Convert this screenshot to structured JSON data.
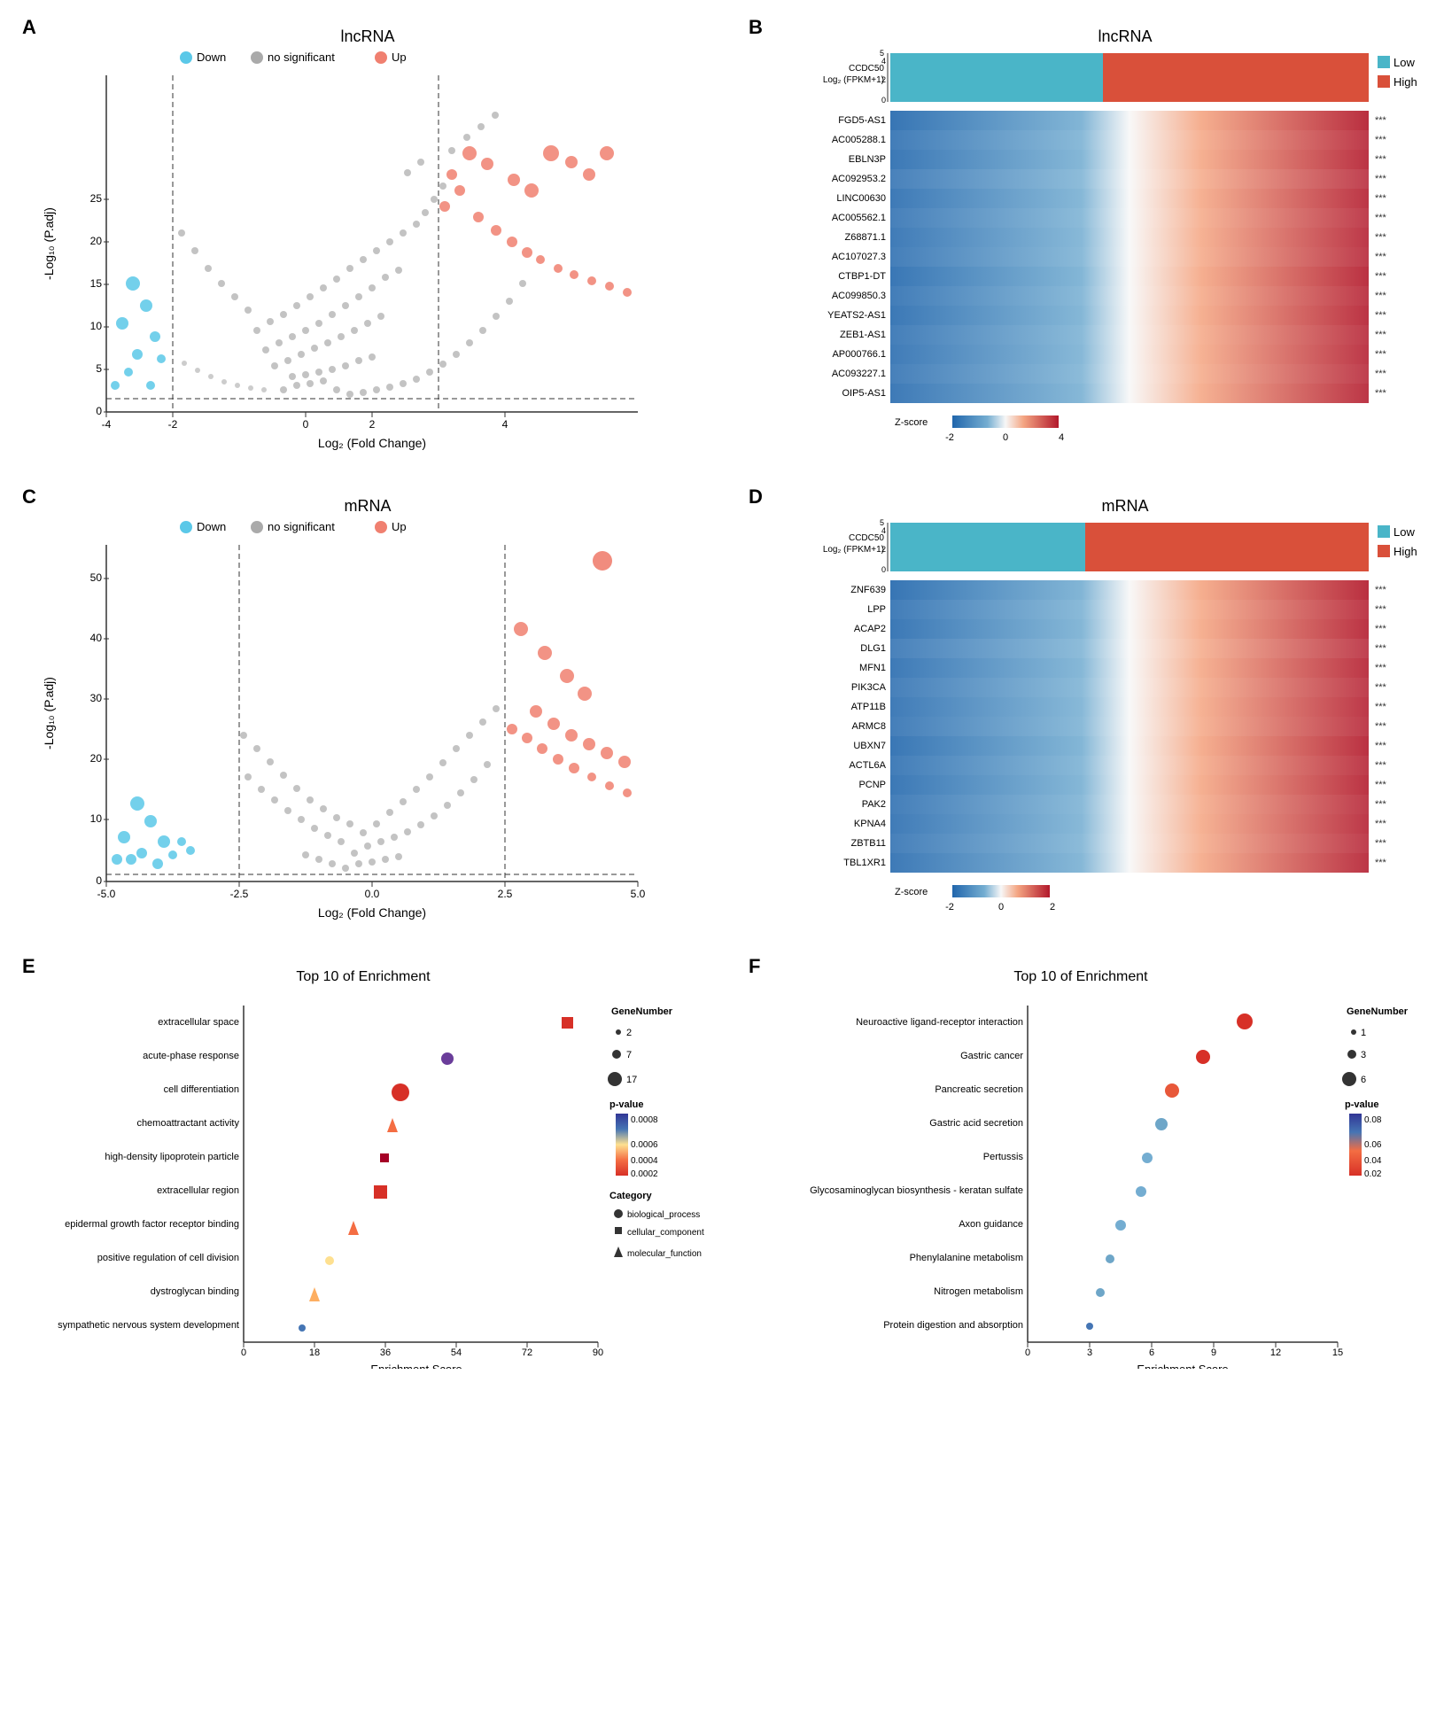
{
  "panels": {
    "A": {
      "label": "A",
      "title": "lncRNA",
      "xLabel": "Log₂ (Fold Change)",
      "yLabel": "-Log₁₀ (P.adj)",
      "legend": [
        {
          "color": "#5bc8e8",
          "label": "Down"
        },
        {
          "color": "#aaaaaa",
          "label": "no significant"
        },
        {
          "color": "#f08070",
          "label": "Up"
        }
      ]
    },
    "B": {
      "label": "B",
      "title": "lncRNA",
      "yLabel": "CCDC50 Log₂ (FPKM+1)",
      "genes": [
        "FGD5-AS1",
        "AC005288.1",
        "EBLN3P",
        "AC092953.2",
        "LINC00630",
        "AC005562.1",
        "Z68871.1",
        "AC107027.3",
        "CTBP1-DT",
        "AC099850.3",
        "YEATS2-AS1",
        "ZEB1-AS1",
        "AP000766.1",
        "AC093227.1",
        "OIP5-AS1"
      ],
      "legend": [
        {
          "color": "#4ab5c8",
          "label": "Low"
        },
        {
          "color": "#d9503a",
          "label": "High"
        }
      ],
      "zscore": {
        "label": "Z-score",
        "min": -2,
        "mid": 0,
        "max": 4
      }
    },
    "C": {
      "label": "C",
      "title": "mRNA",
      "xLabel": "Log₂ (Fold Change)",
      "yLabel": "-Log₁₀ (P.adj)",
      "legend": [
        {
          "color": "#5bc8e8",
          "label": "Down"
        },
        {
          "color": "#aaaaaa",
          "label": "no significant"
        },
        {
          "color": "#f08070",
          "label": "Up"
        }
      ]
    },
    "D": {
      "label": "D",
      "title": "mRNA",
      "yLabel": "CCDC50 Log₂ (FPKM+1)",
      "genes": [
        "ZNF639",
        "LPP",
        "ACAP2",
        "DLG1",
        "MFN1",
        "PIK3CA",
        "ATP11B",
        "ARMC8",
        "UBXN7",
        "ACTL6A",
        "PCNP",
        "PAK2",
        "KPNA4",
        "ZBTB11",
        "TBL1XR1"
      ],
      "legend": [
        {
          "color": "#4ab5c8",
          "label": "Low"
        },
        {
          "color": "#d9503a",
          "label": "High"
        }
      ],
      "zscore": {
        "label": "Z-score",
        "min": -2,
        "mid": 0,
        "max": 2
      }
    },
    "E": {
      "label": "E",
      "title": "Top 10 of Enrichment",
      "xLabel": "Enrichment Score",
      "terms": [
        {
          "name": "extracellular space",
          "score": 82,
          "pvalue": 0.0002,
          "geneNum": 17,
          "category": "cellular_component"
        },
        {
          "name": "acute-phase response",
          "score": 52,
          "pvalue": 0.0003,
          "geneNum": 7,
          "category": "biological_process"
        },
        {
          "name": "cell differentiation",
          "score": 40,
          "pvalue": 0.00015,
          "geneNum": 17,
          "category": "biological_process"
        },
        {
          "name": "chemoattractant activity",
          "score": 38,
          "pvalue": 0.00028,
          "geneNum": 7,
          "category": "molecular_function"
        },
        {
          "name": "high-density lipoprotein particle",
          "score": 36,
          "pvalue": 0.00038,
          "geneNum": 7,
          "category": "cellular_component"
        },
        {
          "name": "extracellular region",
          "score": 35,
          "pvalue": 0.0001,
          "geneNum": 17,
          "category": "cellular_component"
        },
        {
          "name": "epidermal growth factor receptor binding",
          "score": 28,
          "pvalue": 0.00055,
          "geneNum": 2,
          "category": "molecular_function"
        },
        {
          "name": "positive regulation of cell division",
          "score": 22,
          "pvalue": 0.00068,
          "geneNum": 2,
          "category": "biological_process"
        },
        {
          "name": "dystroglycan binding",
          "score": 18,
          "pvalue": 0.00072,
          "geneNum": 2,
          "category": "molecular_function"
        },
        {
          "name": "sympathetic nervous system development",
          "score": 15,
          "pvalue": 0.00078,
          "geneNum": 2,
          "category": "biological_process"
        }
      ],
      "geneNumLegend": [
        2,
        7,
        17
      ],
      "pvalRange": {
        "min": 0.0002,
        "max": 0.0008
      },
      "categoryLegend": [
        {
          "shape": "circle",
          "label": "biological_process"
        },
        {
          "shape": "square",
          "label": "cellular_component"
        },
        {
          "shape": "triangle",
          "label": "molecular_function"
        }
      ]
    },
    "F": {
      "label": "F",
      "title": "Top 10 of Enrichment",
      "xLabel": "Enrichment Score",
      "terms": [
        {
          "name": "Neuroactive ligand-receptor interaction",
          "score": 10.5,
          "pvalue": 0.025,
          "geneNum": 6,
          "category": "circle"
        },
        {
          "name": "Gastric cancer",
          "score": 8.5,
          "pvalue": 0.02,
          "geneNum": 5,
          "category": "circle"
        },
        {
          "name": "Pancreatic secretion",
          "score": 7.0,
          "pvalue": 0.03,
          "geneNum": 5,
          "category": "circle"
        },
        {
          "name": "Gastric acid secretion",
          "score": 6.5,
          "pvalue": 0.07,
          "geneNum": 4,
          "category": "circle"
        },
        {
          "name": "Pertussis",
          "score": 5.8,
          "pvalue": 0.075,
          "geneNum": 3,
          "category": "circle"
        },
        {
          "name": "Glycosaminoglycan biosynthesis - keratan sulfate",
          "score": 5.5,
          "pvalue": 0.065,
          "geneNum": 3,
          "category": "circle"
        },
        {
          "name": "Axon guidance",
          "score": 4.5,
          "pvalue": 0.08,
          "geneNum": 3,
          "category": "circle"
        },
        {
          "name": "Phenylalanine metabolism",
          "score": 4.0,
          "pvalue": 0.075,
          "geneNum": 2,
          "category": "circle"
        },
        {
          "name": "Nitrogen metabolism",
          "score": 3.5,
          "pvalue": 0.07,
          "geneNum": 2,
          "category": "circle"
        },
        {
          "name": "Protein digestion and absorption",
          "score": 3.0,
          "pvalue": 0.085,
          "geneNum": 1,
          "category": "circle"
        }
      ],
      "geneNumLegend": [
        1,
        3,
        6
      ],
      "pvalRange": {
        "min": 0.02,
        "max": 0.08
      }
    }
  }
}
